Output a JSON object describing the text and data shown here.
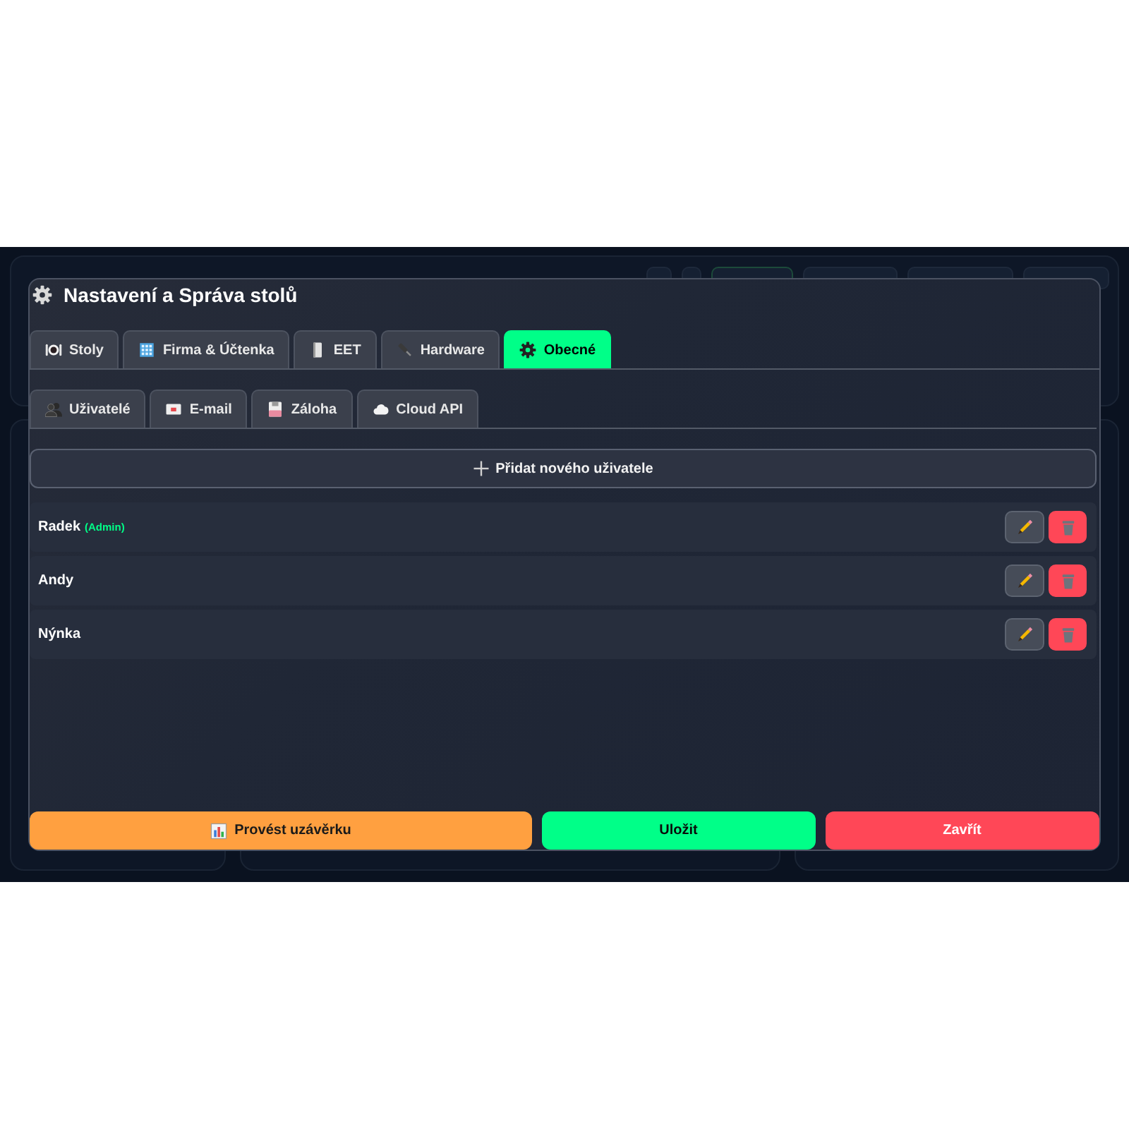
{
  "dialog": {
    "title": "Nastavení a Správa stolů",
    "tabs": [
      {
        "label": "Stoly",
        "selected": false
      },
      {
        "label": "Firma & Účtenka",
        "selected": false
      },
      {
        "label": "EET",
        "selected": false
      },
      {
        "label": "Hardware",
        "selected": false
      },
      {
        "label": "Obecné",
        "selected": true
      }
    ],
    "subtabs": [
      {
        "label": "Uživatelé"
      },
      {
        "label": "E-mail"
      },
      {
        "label": "Záloha"
      },
      {
        "label": "Cloud API"
      }
    ],
    "add_button": {
      "label": "Přidat nového uživatele"
    },
    "users": [
      {
        "name": "Radek",
        "role": "(Admin)"
      },
      {
        "name": "Andy"
      },
      {
        "name": "Nýnka"
      }
    ],
    "footer_buttons": [
      {
        "label": "Provést uzávěrku",
        "kind": "closeout"
      },
      {
        "label": "Uložit",
        "kind": "save"
      },
      {
        "label": "Zavřít",
        "kind": "close"
      }
    ]
  }
}
